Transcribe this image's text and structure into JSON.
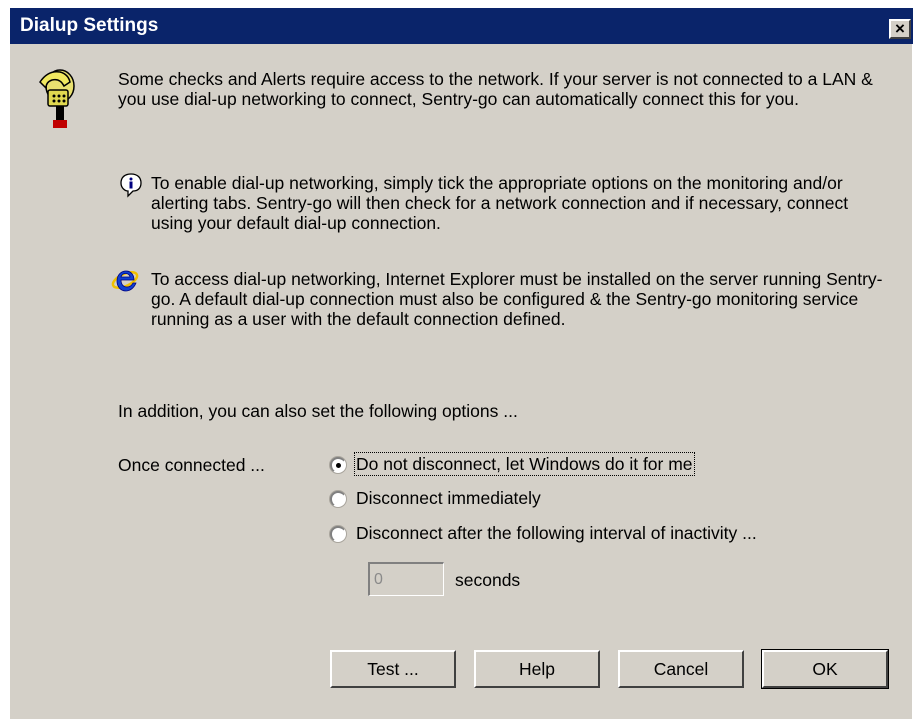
{
  "window": {
    "title": "Dialup Settings",
    "close_glyph": "×"
  },
  "intro": "Some checks and Alerts require access to the network. If your server is not connected to a LAN & you use dial-up networking to connect, Sentry-go can automatically connect this for you.",
  "info_text": "To enable dial-up networking, simply tick the appropriate options on the monitoring and/or alerting tabs. Sentry-go will then check for a network connection and if necessary, connect using your default dial-up connection.",
  "ie_text": "To access dial-up networking, Internet Explorer must be installed on the server running Sentry-go. A default dial-up connection must also be configured & the Sentry-go monitoring service running as a user with the default connection defined.",
  "options_intro": "In addition, you can also set the following options ...",
  "once_connected_label": "Once connected ...",
  "radio_options": [
    {
      "label": "Do not disconnect, let Windows do it for me",
      "checked": true
    },
    {
      "label": "Disconnect immediately",
      "checked": false
    },
    {
      "label": "Disconnect after the following interval of inactivity ...",
      "checked": false
    }
  ],
  "interval": {
    "value": "0",
    "unit_label": "seconds"
  },
  "buttons": {
    "test": "Test ...",
    "help": "Help",
    "cancel": "Cancel",
    "ok": "OK"
  },
  "icons": {
    "phone": "telephone-icon",
    "info": "info-icon",
    "ie": "internet-explorer-icon"
  },
  "colors": {
    "titlebar": "#0a246a",
    "dialog_bg": "#d4d0c8"
  }
}
